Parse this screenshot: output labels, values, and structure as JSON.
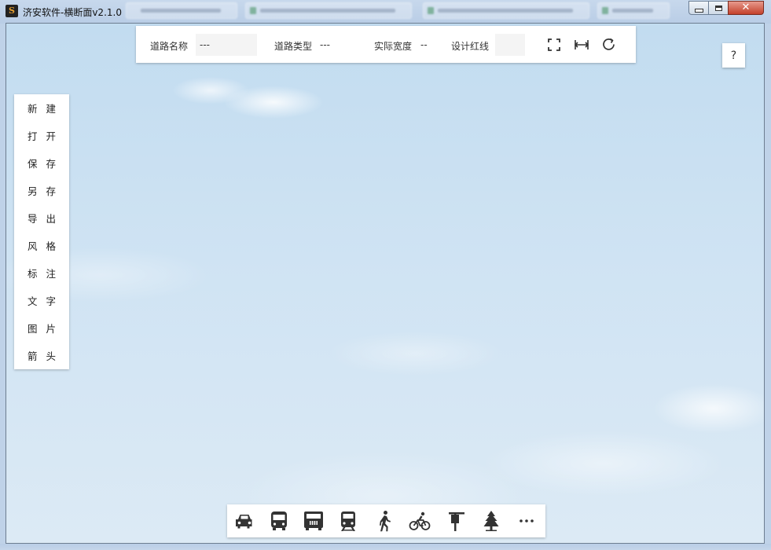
{
  "window": {
    "title": "济安软件-横断面v2.1.0",
    "app_icon_letter": "S",
    "controls": {
      "close": "✕"
    }
  },
  "info_bar": {
    "road_name_label": "道路名称",
    "road_name_value": "---",
    "road_type_label": "道路类型",
    "road_type_value": "---",
    "actual_width_label": "实际宽度",
    "actual_width_value": "--",
    "design_redline_label": "设计红线",
    "design_redline_value": "",
    "tools": [
      "fullscreen-icon",
      "fit-width-icon",
      "refresh-icon"
    ]
  },
  "help": {
    "label": "?"
  },
  "left_menu": {
    "items": [
      "新建",
      "打开",
      "保存",
      "另存",
      "导出",
      "风格",
      "标注",
      "文字",
      "图片",
      "箭头"
    ]
  },
  "bottom_toolbar": {
    "items": [
      "car-icon",
      "bus-icon",
      "truck-icon",
      "tram-icon",
      "pedestrian-icon",
      "bicycle-icon",
      "road-sign-icon",
      "tree-icon",
      "more-icon"
    ],
    "more_label": "···"
  },
  "colors": {
    "accent_close": "#c4412b",
    "icon": "#333333",
    "panel": "#ffffff",
    "sky": "#c2dcf0"
  }
}
